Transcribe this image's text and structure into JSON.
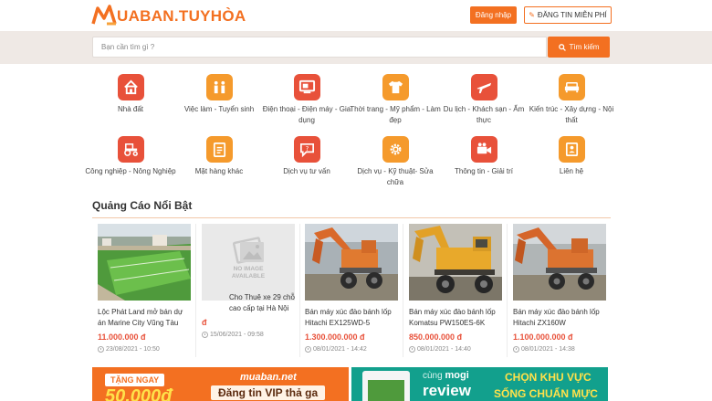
{
  "header": {
    "logo_text": "UABAN.TUYHÒA",
    "login_label": "Đăng nhập",
    "post_label": "ĐĂNG TIN MIỄN PHÍ"
  },
  "search": {
    "placeholder": "Bạn cần tìm gì ?",
    "button_label": "Tìm kiếm"
  },
  "categories": [
    {
      "label": "Nhà đất",
      "icon": "house-icon"
    },
    {
      "label": "Việc làm - Tuyển sinh",
      "icon": "people-icon"
    },
    {
      "label": "Điện thoại - Điện máy - Gia dụng",
      "icon": "tv-icon"
    },
    {
      "label": "Thời trang - Mỹ phẩm - Làm đẹp",
      "icon": "shirt-icon"
    },
    {
      "label": "Du lịch - Khách sạn - Ẩm thực",
      "icon": "plane-icon"
    },
    {
      "label": "Kiến trúc - Xây dựng - Nội thất",
      "icon": "sofa-icon"
    },
    {
      "label": "Công nghiệp - Nông Nghiệp",
      "icon": "tractor-icon"
    },
    {
      "label": "Mặt hàng khác",
      "icon": "clipboard-icon"
    },
    {
      "label": "Dịch vụ tư vấn",
      "icon": "chat-icon"
    },
    {
      "label": "Dịch vụ - Kỹ thuật- Sửa chữa",
      "icon": "gear-icon"
    },
    {
      "label": "Thông tin - Giải trí",
      "icon": "camera-icon"
    },
    {
      "label": "Liên hệ",
      "icon": "contact-icon"
    }
  ],
  "featured": {
    "title": "Quảng Cáo Nổi Bật",
    "items": [
      {
        "title": "Lộc Phát Land mở bán dự án Marine City Vũng Tàu",
        "price": "11.000.000 đ",
        "date": "23/08/2021 - 10:50"
      },
      {
        "title": "Cho Thuê xe 29 chỗ cao cấp tại Hà Nội",
        "price": "đ",
        "date": "15/06/2021 - 09:58",
        "no_image_top": "NO IMAGE",
        "no_image_bottom": "AVAILABLE"
      },
      {
        "title": "Bán máy xúc đào bánh lốp Hitachi EX125WD-5",
        "price": "1.300.000.000 đ",
        "date": "08/01/2021 - 14:42"
      },
      {
        "title": "Bán máy xúc đào bánh lốp Komatsu PW150ES-6K",
        "price": "850.000.000 đ",
        "date": "08/01/2021 - 14:40"
      },
      {
        "title": "Bán máy xúc đào bánh lốp Hitachi ZX160W",
        "price": "1.100.000.000 đ",
        "date": "08/01/2021 - 14:38"
      }
    ]
  },
  "banners": {
    "left": {
      "tag": "TẶNG NGAY",
      "amount": "50.000đ",
      "brand": "muaban.net",
      "headline": "Đăng tin VIP thả ga"
    },
    "right": {
      "prefix": "cùng",
      "brand": "mogi",
      "word": "review",
      "headline_1": "CHỌN KHU VỰC",
      "headline_2": "SỐNG CHUẨN MỰC"
    }
  },
  "colors": {
    "accent": "#f37021",
    "price": "#e8513a",
    "search_band": "#efe9e5"
  }
}
